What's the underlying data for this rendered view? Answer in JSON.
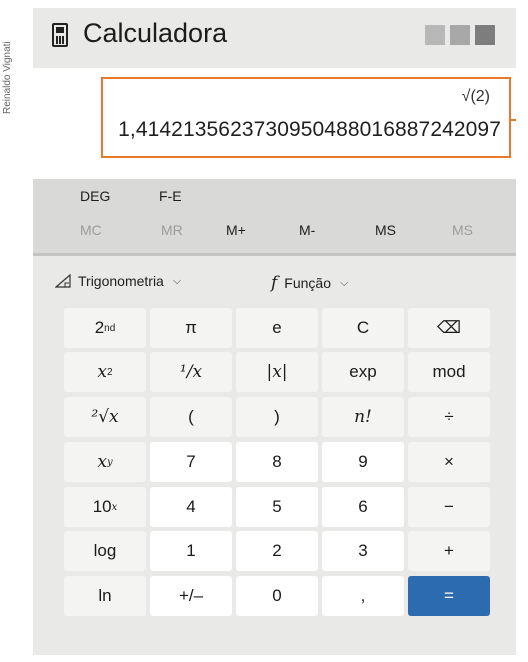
{
  "credit": "Reinaldo Vignati",
  "window": {
    "title": "Calculadora"
  },
  "display": {
    "expression": "√(2)",
    "result": "1,4142135623730950488016887242097"
  },
  "modes": {
    "angle": "DEG",
    "notation": "F-E"
  },
  "memory": [
    "MC",
    "MR",
    "M+",
    "M-",
    "MS",
    "MS"
  ],
  "memory_enabled": [
    false,
    false,
    true,
    true,
    true,
    false
  ],
  "functions_bar": {
    "trig": "Trigonometria",
    "func": "Função"
  },
  "keys": {
    "second": "2",
    "second_sup": "nd",
    "pi": "π",
    "e": "e",
    "clear": "C",
    "backspace": "⌫",
    "square": "x",
    "square_sup": "2",
    "reciprocal": "¹/x",
    "abs": "|x|",
    "exp": "exp",
    "mod": "mod",
    "root": "²√x",
    "lparen": "(",
    "rparen": ")",
    "factorial": "n!",
    "divide": "÷",
    "power": "x",
    "power_sup": "y",
    "seven": "7",
    "eight": "8",
    "nine": "9",
    "multiply": "×",
    "ten_pow": "10",
    "ten_pow_sup": "x",
    "four": "4",
    "five": "5",
    "six": "6",
    "minus": "−",
    "log": "log",
    "one": "1",
    "two": "2",
    "three": "3",
    "plus": "+",
    "ln": "ln",
    "negate": "+/–",
    "zero": "0",
    "decimal": ",",
    "equals": "="
  },
  "colors": {
    "accent": "#2d6bb1",
    "highlight": "#e8782a"
  }
}
